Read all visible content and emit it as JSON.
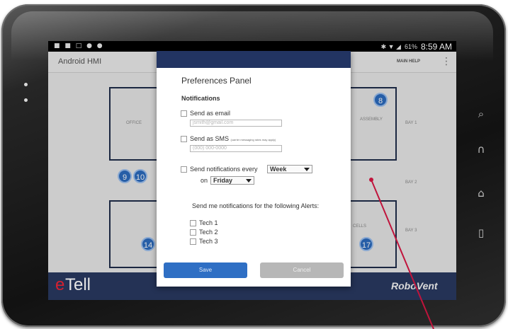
{
  "status_bar": {
    "battery_percent": "61%",
    "time": "8:59 AM"
  },
  "app_bar": {
    "title": "Android HMI",
    "menu": "MAIN HELP",
    "overflow_icon": "more-vert-icon"
  },
  "floor_plan": {
    "zones": [
      "OFFICE",
      "ASSEMBLY",
      "CELLS"
    ],
    "bays": [
      "BAY 1",
      "BAY 2",
      "BAY 3"
    ],
    "tech_markers": [
      "9",
      "10",
      "8",
      "14",
      "17"
    ]
  },
  "dialog": {
    "title": "Preferences Panel",
    "section": "Notifications",
    "email": {
      "label": "Send as email",
      "placeholder": "jsmith@gmail.com"
    },
    "sms": {
      "label": "Send as SMS",
      "note": "(carrier messaging rates may apply)",
      "placeholder": "(000) 000-0000"
    },
    "frequency": {
      "label": "Send notifications every",
      "period": "Week",
      "on_label": "on",
      "day": "Friday"
    },
    "alerts_heading": "Send me notifications for the following Alerts:",
    "alerts": [
      "Tech 1",
      "Tech 2",
      "Tech 3"
    ],
    "save_label": "Save",
    "cancel_label": "Cancel"
  },
  "branding": {
    "logo_e": "e",
    "logo_tell": "Tell",
    "robovent": "RoboVent"
  },
  "colors": {
    "dialog_header": "#223462",
    "save_button": "#2f6fc4",
    "cancel_button": "#b7b7b7",
    "tech_marker": "#2c6bbf",
    "pointer_line": "#c0143c",
    "bottom_bar": "#243255"
  }
}
